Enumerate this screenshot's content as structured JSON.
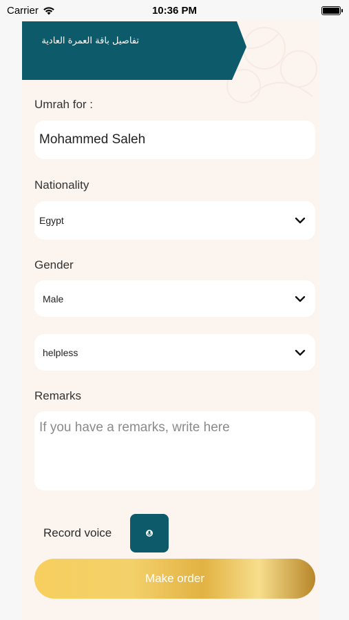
{
  "status_bar": {
    "carrier": "Carrier",
    "time": "10:36 PM"
  },
  "header": {
    "title": "تفاصيل باقة العمرة العادية"
  },
  "form": {
    "umrah_for_label": "Umrah for :",
    "umrah_for_value": "Mohammed Saleh",
    "nationality_label": "Nationality",
    "nationality_value": "Egypt",
    "gender_label": "Gender",
    "gender_value": "Male",
    "condition_value": "helpless",
    "remarks_label": "Remarks",
    "remarks_placeholder": "If you have a remarks, write here",
    "record_voice_label": "Record voice",
    "submit_label": "Make order"
  },
  "colors": {
    "brand_teal": "#0d5a6a",
    "panel_bg": "#fbf4ef",
    "gold": "#f3d06a"
  },
  "icons": [
    "wifi-icon",
    "battery-icon",
    "chevron-down-icon",
    "microphone-icon"
  ]
}
